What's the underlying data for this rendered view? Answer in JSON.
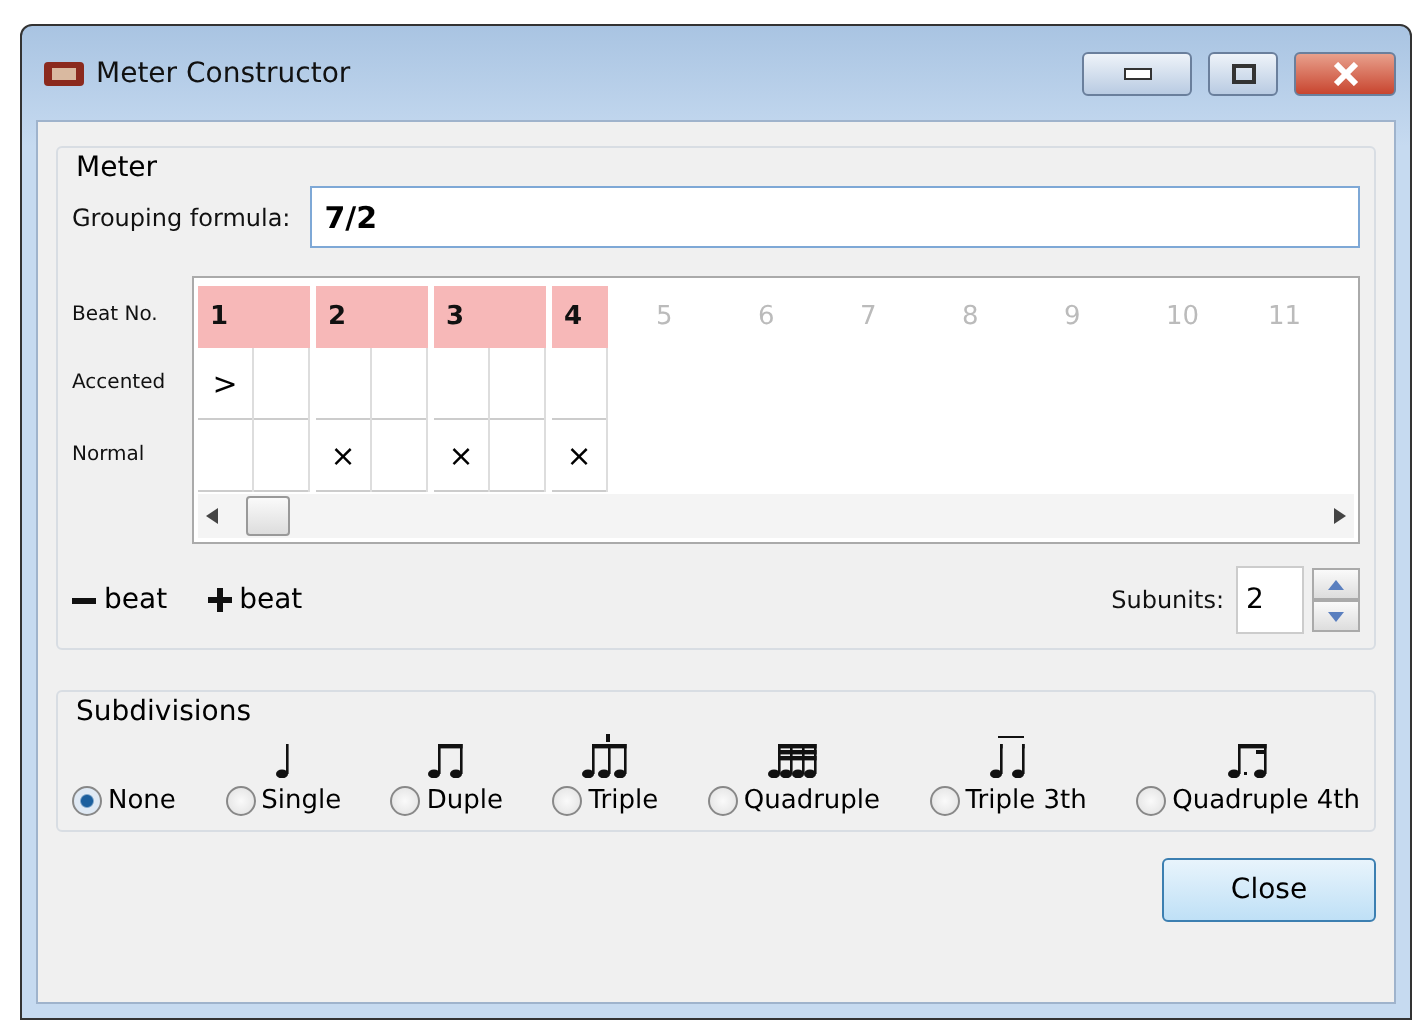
{
  "window": {
    "title": "Meter Constructor"
  },
  "meter": {
    "title": "Meter",
    "formula_label": "Grouping formula:",
    "formula": "7/2",
    "row_labels": [
      "Beat No.",
      "Accented",
      "Normal"
    ],
    "beats": [
      {
        "number": "1",
        "active": true,
        "subunits": [
          {
            "kind": "accent",
            "mark": ">"
          },
          {
            "kind": "blank"
          }
        ]
      },
      {
        "number": "2",
        "active": true,
        "subunits": [
          {
            "kind": "normal",
            "mark": "×"
          },
          {
            "kind": "blank"
          }
        ]
      },
      {
        "number": "3",
        "active": true,
        "subunits": [
          {
            "kind": "normal",
            "mark": "×"
          },
          {
            "kind": "blank"
          }
        ]
      },
      {
        "number": "4",
        "active": true,
        "subunits": [
          {
            "kind": "normal",
            "mark": "×"
          }
        ]
      },
      {
        "number": "5",
        "active": false
      },
      {
        "number": "6",
        "active": false
      },
      {
        "number": "7",
        "active": false
      },
      {
        "number": "8",
        "active": false
      },
      {
        "number": "9",
        "active": false
      },
      {
        "number": "10",
        "active": false
      },
      {
        "number": "11",
        "active": false
      }
    ],
    "remove_beat": "beat",
    "add_beat": "beat",
    "subunits_label": "Subunits:",
    "subunits": "2"
  },
  "subdivisions": {
    "title": "Subdivisions",
    "options": [
      {
        "kind": "none",
        "label": "None",
        "selected": true
      },
      {
        "kind": "single",
        "label": "Single",
        "selected": false
      },
      {
        "kind": "duple",
        "label": "Duple",
        "selected": false
      },
      {
        "kind": "triple",
        "label": "Triple",
        "selected": false
      },
      {
        "kind": "quadruple",
        "label": "Quadruple",
        "selected": false
      },
      {
        "kind": "triple3",
        "label": "Triple 3th",
        "selected": false
      },
      {
        "kind": "quadruple4",
        "label": "Quadruple 4th",
        "selected": false
      }
    ]
  },
  "buttons": [
    "Close"
  ]
}
